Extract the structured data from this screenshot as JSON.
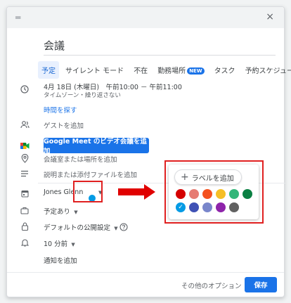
{
  "dialog": {
    "title": "会議",
    "close_label": "×",
    "drag_label": "═"
  },
  "tabs": [
    {
      "label": "予定",
      "active": true
    },
    {
      "label": "サイレント モード"
    },
    {
      "label": "不在"
    },
    {
      "label": "勤務場所",
      "badge": "NEW"
    },
    {
      "label": "タスク"
    },
    {
      "label": "予約スケジュール"
    }
  ],
  "event": {
    "datetime": "4月 18日 (木曜日)　午前10:00 － 午前11:00",
    "repeat": "タイムゾーン・繰り返さない",
    "find_time": "時間を探す",
    "guests": "ゲストを追加",
    "meet_button": "Google Meet のビデオ会議を追加",
    "location": "会議室または場所を追加",
    "description": "説明または添付ファイルを追加",
    "calendar_owner": "Jones Glenn",
    "calendar_color": "#039be5",
    "busy": "予定あり",
    "visibility": "デフォルトの公開設定",
    "reminder": "10 分前",
    "add_notification": "通知を追加"
  },
  "color_picker": {
    "add_label": "ラベルを追加",
    "plus": "+",
    "check": "✓",
    "colors": [
      "#d50000",
      "#e67c73",
      "#f4511e",
      "#f6bf26",
      "#33b679",
      "#0b8043",
      "#039be5",
      "#3f51b5",
      "#7986cb",
      "#8e24aa",
      "#616161"
    ],
    "selected_index": 6
  },
  "footer": {
    "more_options": "その他のオプション",
    "save": "保存"
  }
}
